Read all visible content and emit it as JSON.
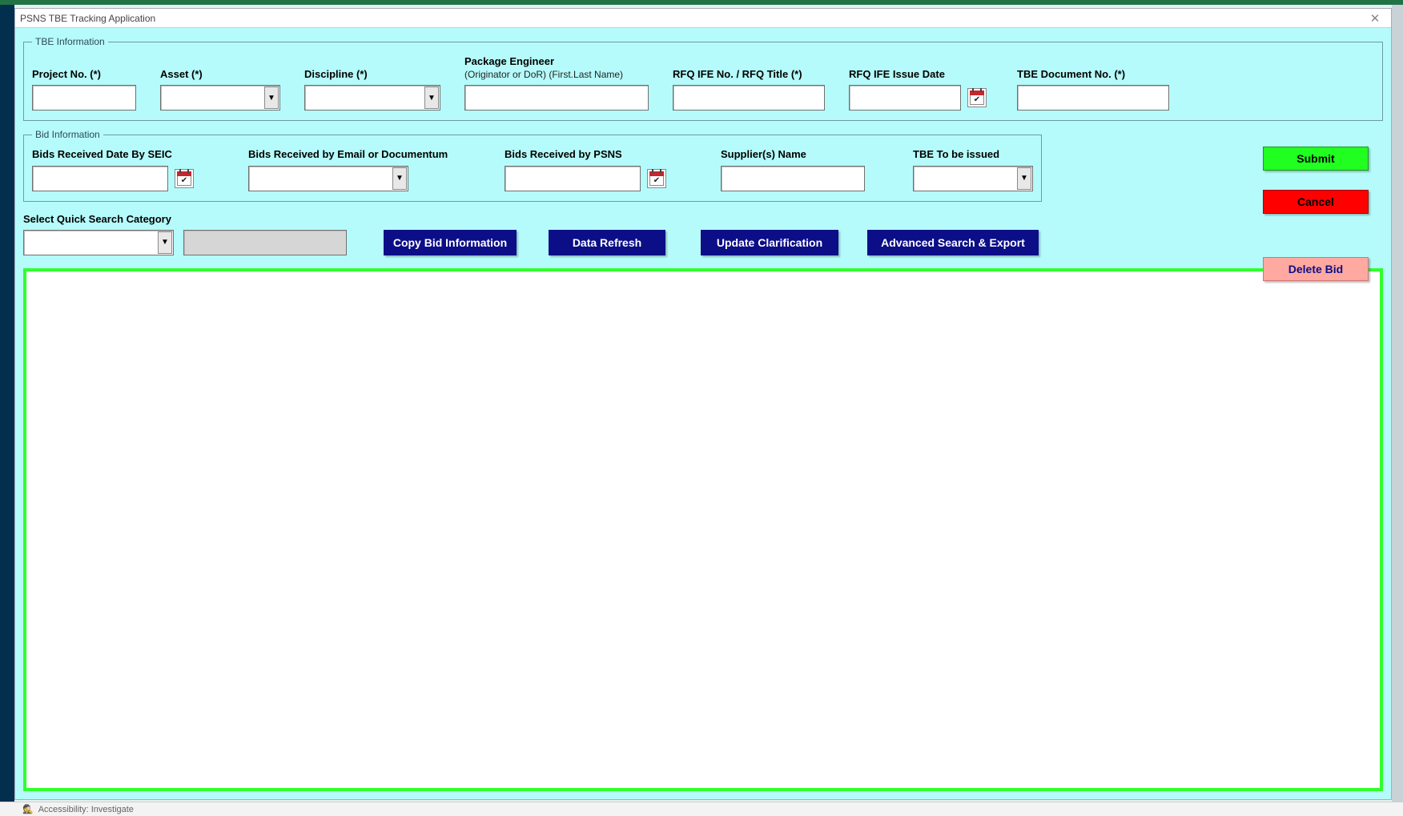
{
  "window": {
    "title": "PSNS TBE Tracking Application"
  },
  "groups": {
    "tbe": {
      "legend": "TBE Information"
    },
    "bid": {
      "legend": "Bid Information"
    }
  },
  "tbe": {
    "project_no": {
      "label": "Project No. (*)",
      "value": ""
    },
    "asset": {
      "label": "Asset (*)",
      "value": ""
    },
    "discipline": {
      "label": "Discipline (*)",
      "value": ""
    },
    "package_engineer": {
      "label": "Package Engineer",
      "sublabel": "(Originator or DoR) (First.Last Name)",
      "value": ""
    },
    "rfq_no": {
      "label": "RFQ IFE No. / RFQ Title (*)",
      "value": ""
    },
    "rfq_date": {
      "label": "RFQ IFE Issue Date",
      "value": ""
    },
    "tbe_doc_no": {
      "label": "TBE Document No. (*)",
      "value": ""
    }
  },
  "bid": {
    "seic_date": {
      "label": "Bids Received Date By SEIC",
      "value": ""
    },
    "method": {
      "label": "Bids Received by Email or Documentum",
      "value": ""
    },
    "psns_date": {
      "label": "Bids Received by PSNS",
      "value": ""
    },
    "supplier": {
      "label": "Supplier(s) Name",
      "value": ""
    },
    "tbe_issue": {
      "label": "TBE To be issued",
      "value": ""
    }
  },
  "search": {
    "label": "Select Quick Search Category",
    "category_value": "",
    "term_value": ""
  },
  "buttons": {
    "copy_bid": "Copy Bid Information",
    "refresh": "Data Refresh",
    "update_clar": "Update Clarification",
    "adv_search": "Advanced Search & Export",
    "submit": "Submit",
    "cancel": "Cancel",
    "delete_bid": "Delete Bid"
  },
  "statusbar": {
    "accessibility": "Accessibility: Investigate"
  },
  "icons": {
    "calendar": "calendar-icon",
    "close": "close-icon",
    "chevron_down": "chevron-down-icon"
  }
}
